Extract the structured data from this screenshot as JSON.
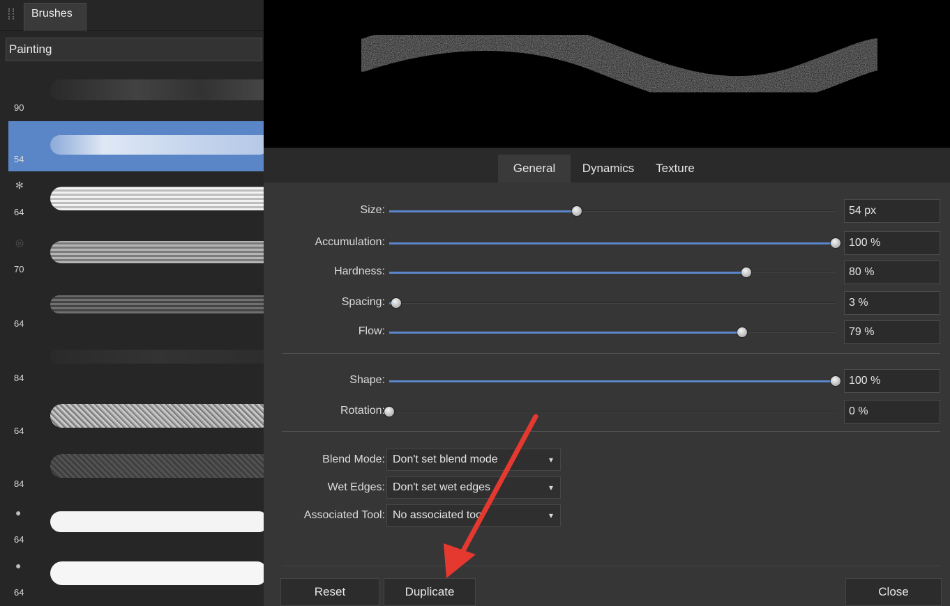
{
  "panel": {
    "tab_label": "Brushes",
    "category": "Painting"
  },
  "brushes": [
    {
      "size": "90",
      "style": "faint",
      "selected": false
    },
    {
      "size": "54",
      "style": "light",
      "selected": true
    },
    {
      "size": "64",
      "style": "bright",
      "selected": false
    },
    {
      "size": "70",
      "style": "gray",
      "selected": false
    },
    {
      "size": "64",
      "style": "dark",
      "selected": false
    },
    {
      "size": "84",
      "style": "very-dark",
      "selected": false
    },
    {
      "size": "64",
      "style": "speckle",
      "selected": false
    },
    {
      "size": "84",
      "style": "dim-speckle",
      "selected": false
    },
    {
      "size": "64",
      "style": "white",
      "selected": false
    },
    {
      "size": "64",
      "style": "white",
      "selected": false
    }
  ],
  "tabs": {
    "general": "General",
    "dynamics": "Dynamics",
    "texture": "Texture"
  },
  "sliders": [
    {
      "label": "Size:",
      "value": "54 px",
      "fraction": 0.42
    },
    {
      "label": "Accumulation:",
      "value": "100 %",
      "fraction": 1.0
    },
    {
      "label": "Hardness:",
      "value": "80 %",
      "fraction": 0.8
    },
    {
      "label": "Spacing:",
      "value": "3 %",
      "fraction": 0.015
    },
    {
      "label": "Flow:",
      "value": "79 %",
      "fraction": 0.79
    }
  ],
  "shape_sliders": [
    {
      "label": "Shape:",
      "value": "100 %",
      "fraction": 1.0
    },
    {
      "label": "Rotation:",
      "value": "0 %",
      "fraction": 0.0
    }
  ],
  "dropdowns": [
    {
      "label": "Blend Mode:",
      "value": "Don't set blend mode"
    },
    {
      "label": "Wet Edges:",
      "value": "Don't set wet edges"
    },
    {
      "label": "Associated Tool:",
      "value": "No associated tool"
    }
  ],
  "buttons": {
    "reset": "Reset",
    "duplicate": "Duplicate",
    "close": "Close"
  },
  "colors": {
    "accent": "#5a86c8",
    "arrow": "#e5392f"
  }
}
